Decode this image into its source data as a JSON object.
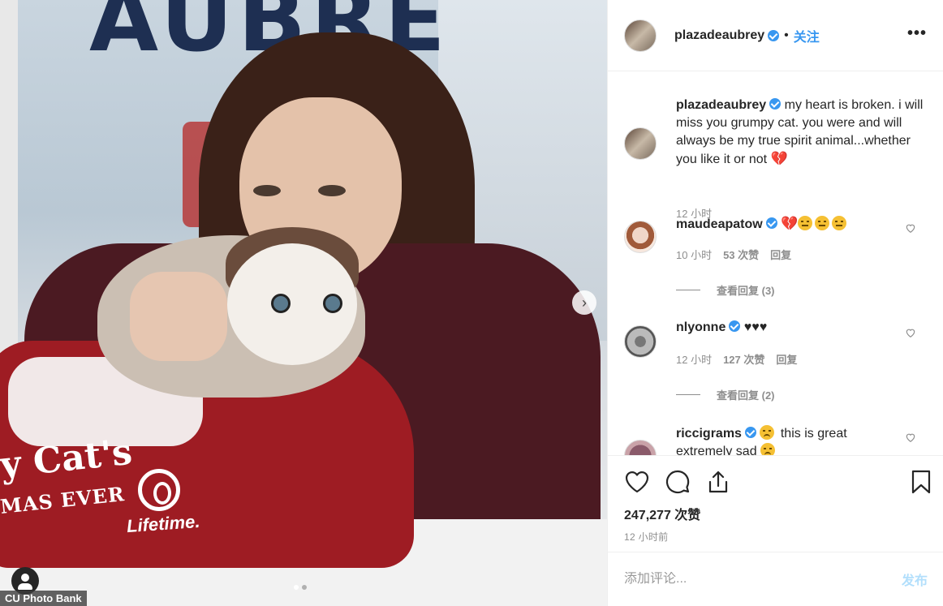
{
  "photo": {
    "banner_text": "AUBRE",
    "bed_title": "y Cat's",
    "bed_sub": "MAS EVER",
    "bed_logo": "Lifetime.",
    "credit": "CU Photo Bank",
    "next_icon": "chevron-right-icon",
    "carousel_count": 2,
    "carousel_active": 0
  },
  "header": {
    "username": "plazadeaubrey",
    "verified": true,
    "separator": "•",
    "follow_label": "关注",
    "more_icon": "more-options-icon",
    "more_label": "•••"
  },
  "caption": {
    "username": "plazadeaubrey",
    "text": "my heart is broken. i will miss you grumpy cat. you were and will always be my true spirit animal...whether you like it or not",
    "time": "12 小时"
  },
  "comments": [
    {
      "username": "maudeapatow",
      "text": "💔😔😔😔",
      "time": "10 小时",
      "likes": "53 次赞",
      "reply_label": "回复",
      "view_replies": "查看回复 (3)"
    },
    {
      "username": "nlyonne",
      "text": "♥♥♥",
      "time": "12 小时",
      "likes": "127 次赞",
      "reply_label": "回复",
      "view_replies": "查看回复 (2)"
    },
    {
      "username": "riccigrams",
      "text": "this is great",
      "text2": "extremely sad"
    }
  ],
  "actions": {
    "like_count": "247,277 次赞",
    "time_ago": "12 小时前"
  },
  "add_comment": {
    "placeholder": "添加评论...",
    "post_label": "发布"
  },
  "colors": {
    "accent": "#3897f0",
    "muted": "#8e8e8e",
    "post_disabled": "#b2dffc"
  }
}
